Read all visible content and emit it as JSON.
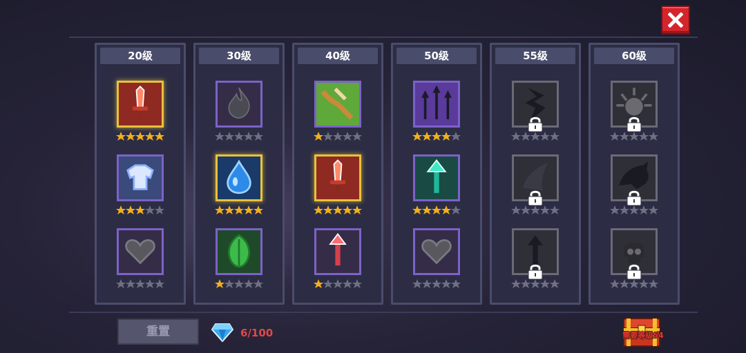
{
  "close_button": {
    "icon": "close-icon",
    "color": "#d5242c"
  },
  "columns": [
    {
      "level": "20级",
      "skills": [
        {
          "icon": "sword-icon",
          "stars": 5,
          "highlight": true,
          "locked": false
        },
        {
          "icon": "armor-icon",
          "stars": 3,
          "highlight": false,
          "locked": false
        },
        {
          "icon": "heart-icon",
          "stars": 0,
          "highlight": false,
          "locked": false
        }
      ]
    },
    {
      "level": "30级",
      "skills": [
        {
          "icon": "fire-icon",
          "stars": 0,
          "highlight": false,
          "locked": false
        },
        {
          "icon": "water-drop-icon",
          "stars": 5,
          "highlight": true,
          "locked": false
        },
        {
          "icon": "leaf-icon",
          "stars": 1,
          "highlight": false,
          "locked": false
        }
      ]
    },
    {
      "level": "40级",
      "skills": [
        {
          "icon": "crossbow-icon",
          "stars": 1,
          "highlight": false,
          "locked": false
        },
        {
          "icon": "sword-icon",
          "stars": 5,
          "highlight": true,
          "locked": false
        },
        {
          "icon": "red-arrow-icon",
          "stars": 1,
          "highlight": false,
          "locked": false
        }
      ]
    },
    {
      "level": "50级",
      "skills": [
        {
          "icon": "triple-arrow-icon",
          "stars": 4,
          "highlight": false,
          "locked": false
        },
        {
          "icon": "green-arrow-icon",
          "stars": 4,
          "highlight": false,
          "locked": false
        },
        {
          "icon": "heart-icon",
          "stars": 0,
          "highlight": false,
          "locked": false
        }
      ]
    },
    {
      "level": "55级",
      "skills": [
        {
          "icon": "lightning-icon",
          "stars": 0,
          "highlight": false,
          "locked": true
        },
        {
          "icon": "horn-icon",
          "stars": 0,
          "highlight": false,
          "locked": true
        },
        {
          "icon": "dark-arrow-icon",
          "stars": 0,
          "highlight": false,
          "locked": true
        }
      ]
    },
    {
      "level": "60级",
      "skills": [
        {
          "icon": "light-burst-icon",
          "stars": 0,
          "highlight": false,
          "locked": true
        },
        {
          "icon": "dragon-icon",
          "stars": 0,
          "highlight": false,
          "locked": true
        },
        {
          "icon": "skull-icon",
          "stars": 0,
          "highlight": false,
          "locked": true
        }
      ]
    }
  ],
  "max_stars": 5,
  "footer": {
    "reset_label": "重置",
    "gem_icon": "diamond-icon",
    "gem_count": "6/100",
    "chest_icon": "treasure-chest-icon",
    "chest_label": "需要等级54"
  },
  "colors": {
    "star_on": "#f2b01e",
    "star_off": "#6f7084",
    "gold_border": "#e9c23a",
    "purple_border": "#7d62c9",
    "gem_count": "#e14848"
  }
}
